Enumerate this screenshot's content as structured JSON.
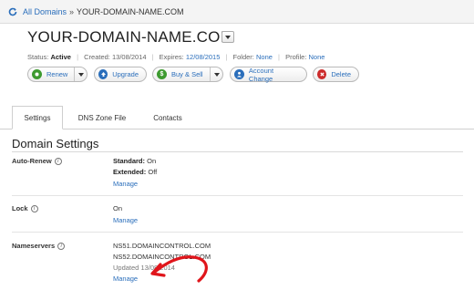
{
  "breadcrumb": {
    "root": "All Domains",
    "separator": "»",
    "current": "YOUR-DOMAIN-NAME.COM"
  },
  "domain": {
    "name": "YOUR-DOMAIN-NAME.COM"
  },
  "meta": {
    "status_label": "Status:",
    "status_value": "Active",
    "created_label": "Created:",
    "created_value": "13/08/2014",
    "expires_label": "Expires:",
    "expires_value": "12/08/2015",
    "folder_label": "Folder:",
    "folder_value": "None",
    "profile_label": "Profile:",
    "profile_value": "None",
    "separator": "|"
  },
  "actions": {
    "renew": "Renew",
    "upgrade": "Upgrade",
    "buy_sell": "Buy & Sell",
    "account_change": "Account Change",
    "delete": "Delete",
    "colors": {
      "renew": "#3d9a2f",
      "upgrade": "#2a6ebb",
      "buy_sell": "#3d9a2f",
      "account_change": "#2a6ebb",
      "delete": "#cc2b2b"
    }
  },
  "tabs": [
    {
      "label": "Settings",
      "active": true
    },
    {
      "label": "DNS Zone File",
      "active": false
    },
    {
      "label": "Contacts",
      "active": false
    }
  ],
  "section": {
    "title": "Domain Settings"
  },
  "auto_renew": {
    "label": "Auto-Renew",
    "standard_label": "Standard:",
    "standard_value": "On",
    "extended_label": "Extended:",
    "extended_value": "Off",
    "manage": "Manage"
  },
  "lock": {
    "label": "Lock",
    "value": "On",
    "manage": "Manage"
  },
  "nameservers": {
    "label": "Nameservers",
    "ns1": "NS51.DOMAINCONTROL.COM",
    "ns2": "NS52.DOMAINCONTROL.COM",
    "updated": "Updated 13/08/2014",
    "manage": "Manage"
  },
  "annotation": {
    "arrow_color": "#e0151b"
  },
  "icons": {
    "refresh": "refresh-icon",
    "info": "info-icon",
    "dropdown": "chevron-down-icon"
  }
}
